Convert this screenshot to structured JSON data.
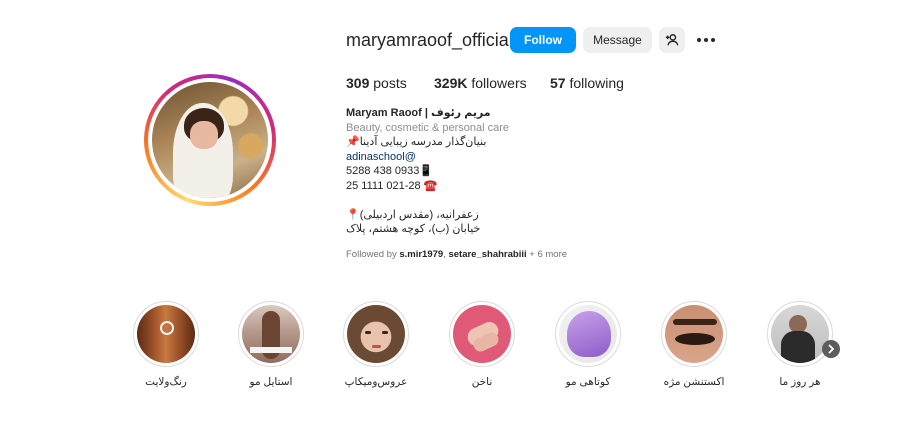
{
  "profile": {
    "username": "maryamraoof_official",
    "follow_label": "Follow",
    "message_label": "Message",
    "stats": {
      "posts": "309",
      "posts_label": "posts",
      "followers": "329K",
      "followers_label": "followers",
      "following": "57",
      "following_label": "following"
    },
    "bio": {
      "name": "Maryam Raoof | مریم رئوف",
      "category": "Beauty, cosmetic & personal care",
      "line1": "📌بنیان‌گذار مدرسه زیبایی آدینا",
      "line2": "adinaschool@",
      "line3": "5288 438 0933📱",
      "line4": "25 1111 021-28 ☎️",
      "line5": "📍زعفرانیه، (مقدس اردبیلی)",
      "line6": "خیابان (ب)، کوچه هشتم، پلاک"
    },
    "followed_by": {
      "prefix": "Followed by ",
      "user1": "s.mir1979",
      "sep": ", ",
      "user2": "setare_shahrabiii",
      "suffix": " + 6 more"
    }
  },
  "highlights": [
    {
      "label": "رنگ‌ولایت"
    },
    {
      "label": "استایل مو"
    },
    {
      "label": "عروس‌ومیکاپ"
    },
    {
      "label": "ناخن"
    },
    {
      "label": "کوتاهی مو"
    },
    {
      "label": "اکستنشن مژه"
    },
    {
      "label": "هر روز ما"
    }
  ],
  "icons": {
    "add_user": "add-user-icon",
    "more": "more-options-icon",
    "next": "chevron-right-icon"
  },
  "colors": {
    "follow_button": "#0095f6",
    "secondary_button": "#efefef",
    "link": "#00376b"
  }
}
